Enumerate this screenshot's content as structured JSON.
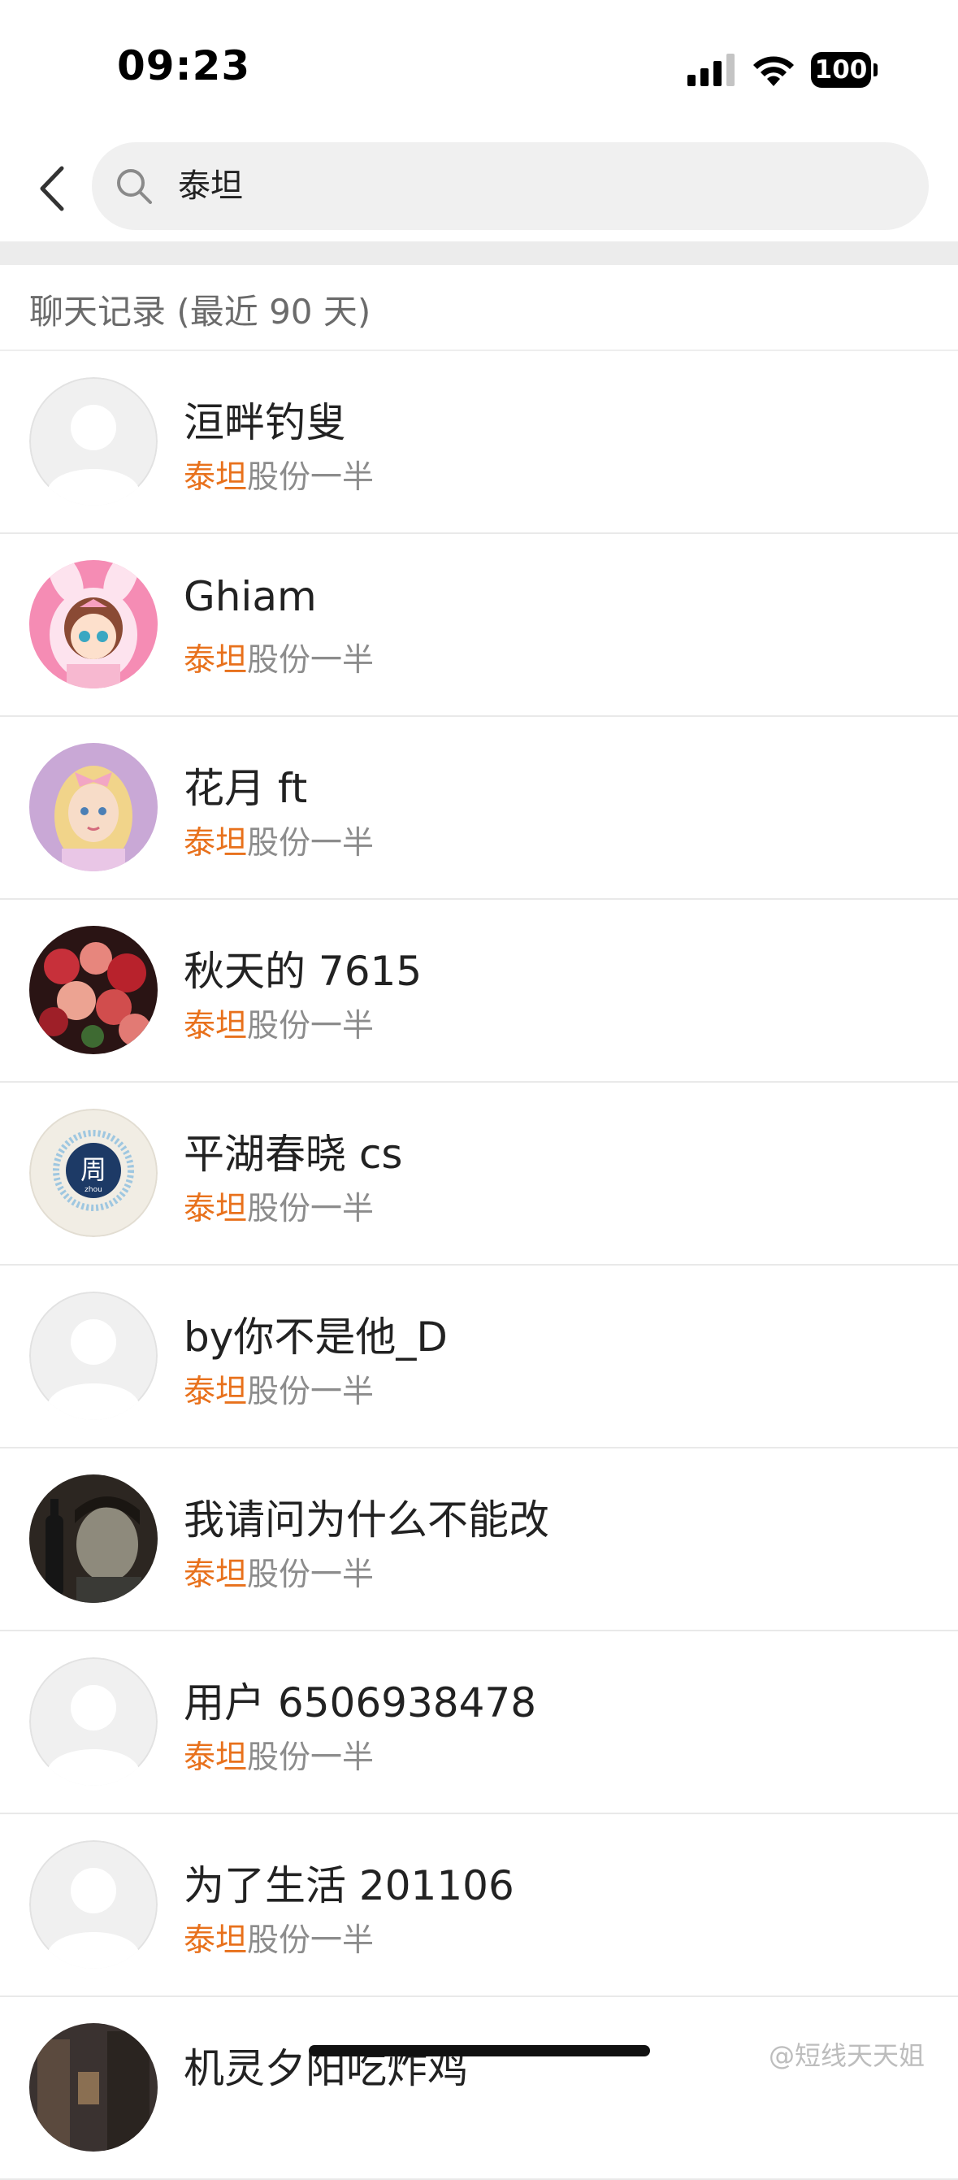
{
  "status_bar": {
    "time": "09:23",
    "battery": "100"
  },
  "search": {
    "query": "泰坦"
  },
  "section": {
    "title": "聊天记录 (最近 90 天)"
  },
  "results": [
    {
      "name": "洹畔钓叟",
      "keyword": "泰坦",
      "snippet_rest": "股份一半",
      "avatar": "default-avatar"
    },
    {
      "name": "Ghiam",
      "keyword": "泰坦",
      "snippet_rest": "股份一半",
      "avatar": "anime-girl-bunny-hood"
    },
    {
      "name": "花月 ft",
      "keyword": "泰坦",
      "snippet_rest": "股份一半",
      "avatar": "doll-girl-bow"
    },
    {
      "name": "秋天的 7615",
      "keyword": "泰坦",
      "snippet_rest": "股份一半",
      "avatar": "red-flowers"
    },
    {
      "name": "平湖春晓 cs",
      "keyword": "泰坦",
      "snippet_rest": "股份一半",
      "avatar": "zhou-seal"
    },
    {
      "name": "by你不是他_D",
      "keyword": "泰坦",
      "snippet_rest": "股份一半",
      "avatar": "default-avatar"
    },
    {
      "name": "我请问为什么不能改",
      "keyword": "泰坦",
      "snippet_rest": "股份一半",
      "avatar": "person-photo"
    },
    {
      "name": "用户 6506938478",
      "keyword": "泰坦",
      "snippet_rest": "股份一半",
      "avatar": "default-avatar"
    },
    {
      "name": "为了生活 201106",
      "keyword": "泰坦",
      "snippet_rest": "股份一半",
      "avatar": "default-avatar"
    },
    {
      "name": "机灵夕阳吃炸鸡",
      "keyword": "",
      "snippet_rest": "",
      "avatar": "street-photo"
    }
  ],
  "avatar_badge": {
    "zhou_char": "周",
    "zhou_pinyin": "zhou"
  },
  "watermark": "@短线天天姐",
  "colors": {
    "keyword": "#e8711c",
    "divider": "#e9e9e9",
    "search_bg": "#f0f0f0"
  }
}
